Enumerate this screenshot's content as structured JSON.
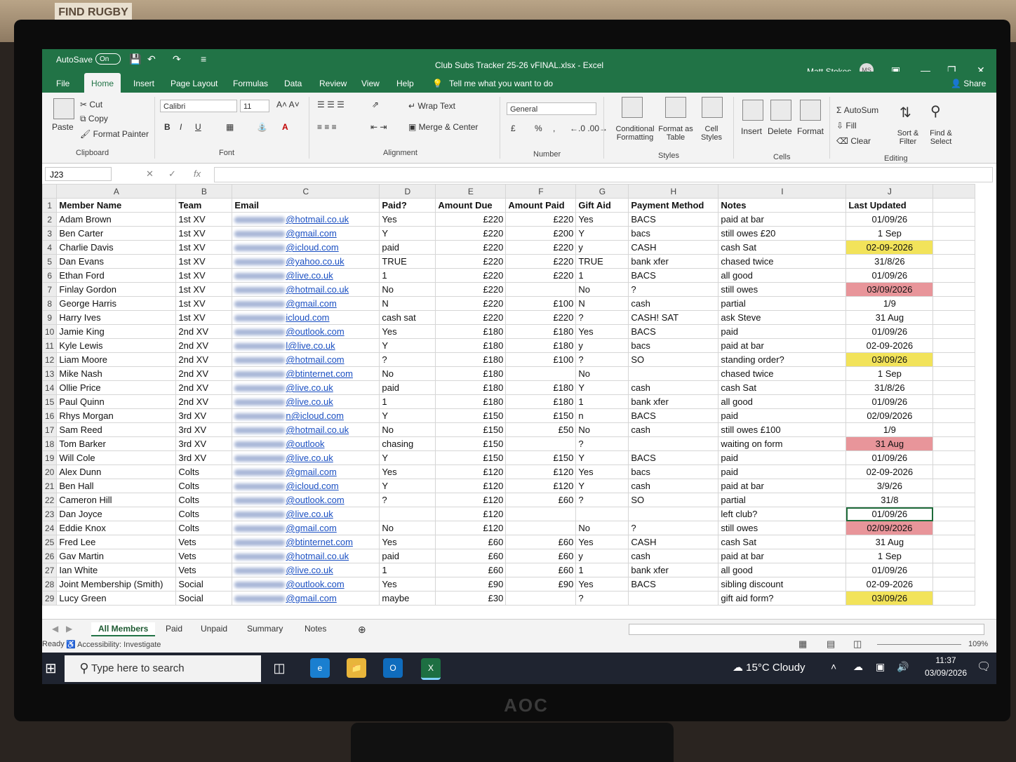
{
  "window": {
    "title": "Club Subs Tracker 25-26 vFINAL.xlsx  -  Excel",
    "autosave_label": "AutoSave",
    "autosave_state": "On",
    "user_name": "Matt Stokes",
    "user_initials": "MS",
    "share_label": "Share",
    "wall_sign": "FIND RUGBY",
    "monitor_brand": "AOC"
  },
  "menu": {
    "tabs": [
      "File",
      "Home",
      "Insert",
      "Page Layout",
      "Formulas",
      "Data",
      "Review",
      "View",
      "Help"
    ],
    "tell_me": "Tell me what you want to do"
  },
  "ribbon": {
    "clipboard": {
      "paste": "Paste",
      "cut": "Cut",
      "copy": "Copy",
      "format_painter": "Format Painter",
      "group": "Clipboard"
    },
    "font": {
      "name": "Calibri",
      "size": "11",
      "group": "Font"
    },
    "alignment": {
      "wrap": "Wrap Text",
      "merge": "Merge & Center",
      "group": "Alignment"
    },
    "number": {
      "format": "General",
      "group": "Number",
      "currency": "£",
      "percent": "%",
      "comma": ","
    },
    "styles": {
      "conditional": "Conditional Formatting",
      "format_table": "Format as Table",
      "cell_styles": "Cell Styles",
      "group": "Styles"
    },
    "cells": {
      "insert": "Insert",
      "delete": "Delete",
      "format": "Format",
      "group": "Cells"
    },
    "editing": {
      "autosum": "AutoSum",
      "fill": "Fill",
      "clear": "Clear",
      "sort": "Sort & Filter",
      "find": "Find & Select",
      "group": "Editing"
    }
  },
  "formula_bar": {
    "name_box": "J23",
    "fx": "fx"
  },
  "columns": [
    "A",
    "B",
    "C",
    "D",
    "E",
    "F",
    "G",
    "H",
    "I",
    "J"
  ],
  "header_row": [
    "Member Name",
    "Team",
    "Email",
    "Paid?",
    "Amount Due",
    "Amount Paid",
    "Gift Aid",
    "Payment Method",
    "Notes",
    "Last Updated"
  ],
  "rows": [
    {
      "n": "2",
      "a": "Adam Brown",
      "b": "1st XV",
      "c": "@hotmail.co.uk",
      "d": "Yes",
      "e": "£220",
      "f": "£220",
      "g": "Yes",
      "h": "BACS",
      "i": "paid at bar",
      "j": "01/09/26",
      "hl": ""
    },
    {
      "n": "3",
      "a": "Ben Carter",
      "b": "1st XV",
      "c": "@gmail.com",
      "d": "Y",
      "e": "£220",
      "f": "£200",
      "g": "Y",
      "h": "bacs",
      "i": "still owes £20",
      "j": "1 Sep",
      "hl": ""
    },
    {
      "n": "4",
      "a": "Charlie Davis",
      "b": "1st XV",
      "c": "@icloud.com",
      "d": "paid",
      "e": "£220",
      "f": "£220",
      "g": "y",
      "h": "CASH",
      "i": "cash Sat",
      "j": "02-09-2026",
      "hl": "yel"
    },
    {
      "n": "5",
      "a": "Dan Evans",
      "b": "1st XV",
      "c": "@yahoo.co.uk",
      "d": "TRUE",
      "e": "£220",
      "f": "£220",
      "g": "TRUE",
      "h": "bank xfer",
      "i": "chased twice",
      "j": "31/8/26",
      "hl": ""
    },
    {
      "n": "6",
      "a": "Ethan Ford",
      "b": "1st XV",
      "c": "@live.co.uk",
      "d": "1",
      "e": "£220",
      "f": "£220",
      "g": "1",
      "h": "BACS",
      "i": "all good",
      "j": "01/09/26",
      "hl": ""
    },
    {
      "n": "7",
      "a": "Finlay Gordon",
      "b": "1st XV",
      "c": "@hotmail.co.uk",
      "d": "No",
      "e": "£220",
      "f": "",
      "g": "No",
      "h": "?",
      "i": "still owes",
      "j": "03/09/2026",
      "hl": "red"
    },
    {
      "n": "8",
      "a": "George Harris",
      "b": "1st XV",
      "c": "@gmail.com",
      "d": "N",
      "e": "£220",
      "f": "£100",
      "g": "N",
      "h": "cash",
      "i": "partial",
      "j": "1/9",
      "hl": ""
    },
    {
      "n": "9",
      "a": "Harry Ives",
      "b": "1st XV",
      "c": "icloud.com",
      "d": "cash sat",
      "e": "£220",
      "f": "£220",
      "g": "?",
      "h": "CASH! SAT",
      "i": "ask Steve",
      "j": "31 Aug",
      "hl": ""
    },
    {
      "n": "10",
      "a": "Jamie King",
      "b": "2nd XV",
      "c": "@outlook.com",
      "d": "Yes",
      "e": "£180",
      "f": "£180",
      "g": "Yes",
      "h": "BACS",
      "i": "paid",
      "j": "01/09/26",
      "hl": ""
    },
    {
      "n": "11",
      "a": "Kyle Lewis",
      "b": "2nd XV",
      "c": "l@live.co.uk",
      "d": "Y",
      "e": "£180",
      "f": "£180",
      "g": "y",
      "h": "bacs",
      "i": "paid at bar",
      "j": "02-09-2026",
      "hl": ""
    },
    {
      "n": "12",
      "a": "Liam Moore",
      "b": "2nd XV",
      "c": "@hotmail.com",
      "d": "?",
      "e": "£180",
      "f": "£100",
      "g": "?",
      "h": "SO",
      "i": "standing order?",
      "j": "03/09/26",
      "hl": "yel"
    },
    {
      "n": "13",
      "a": "Mike Nash",
      "b": "2nd XV",
      "c": "@btinternet.com",
      "d": "No",
      "e": "£180",
      "f": "",
      "g": "No",
      "h": "",
      "i": "chased twice",
      "j": "1 Sep",
      "hl": ""
    },
    {
      "n": "14",
      "a": "Ollie Price",
      "b": "2nd XV",
      "c": "@live.co.uk",
      "d": "paid",
      "e": "£180",
      "f": "£180",
      "g": "Y",
      "h": "cash",
      "i": "cash Sat",
      "j": "31/8/26",
      "hl": ""
    },
    {
      "n": "15",
      "a": "Paul Quinn",
      "b": "2nd XV",
      "c": "@live.co.uk",
      "d": "1",
      "e": "£180",
      "f": "£180",
      "g": "1",
      "h": "bank xfer",
      "i": "all good",
      "j": "01/09/26",
      "hl": ""
    },
    {
      "n": "16",
      "a": "Rhys Morgan",
      "b": "3rd XV",
      "c": "n@icloud.com",
      "d": "Y",
      "e": "£150",
      "f": "£150",
      "g": "n",
      "h": "BACS",
      "i": "paid",
      "j": "02/09/2026",
      "hl": ""
    },
    {
      "n": "17",
      "a": "Sam Reed",
      "b": "3rd XV",
      "c": "@hotmail.co.uk",
      "d": "No",
      "e": "£150",
      "f": "£50",
      "g": "No",
      "h": "cash",
      "i": "still owes £100",
      "j": "1/9",
      "hl": ""
    },
    {
      "n": "18",
      "a": "Tom Barker",
      "b": "3rd XV",
      "c": "@outlook",
      "d": "chasing",
      "e": "£150",
      "f": "",
      "g": "?",
      "h": "",
      "i": "waiting on form",
      "j": "31 Aug",
      "hl": "red"
    },
    {
      "n": "19",
      "a": "Will Cole",
      "b": "3rd XV",
      "c": "@live.co.uk",
      "d": "Y",
      "e": "£150",
      "f": "£150",
      "g": "Y",
      "h": "BACS",
      "i": "paid",
      "j": "01/09/26",
      "hl": ""
    },
    {
      "n": "20",
      "a": "Alex Dunn",
      "b": "Colts",
      "c": "@gmail.com",
      "d": "Yes",
      "e": "£120",
      "f": "£120",
      "g": "Yes",
      "h": "bacs",
      "i": "paid",
      "j": "02-09-2026",
      "hl": ""
    },
    {
      "n": "21",
      "a": "Ben Hall",
      "b": "Colts",
      "c": "@icloud.com",
      "d": "Y",
      "e": "£120",
      "f": "£120",
      "g": "Y",
      "h": "cash",
      "i": "paid at bar",
      "j": "3/9/26",
      "hl": ""
    },
    {
      "n": "22",
      "a": "Cameron Hill",
      "b": "Colts",
      "c": "@outlook.com",
      "d": "?",
      "e": "£120",
      "f": "£60",
      "g": "?",
      "h": "SO",
      "i": "partial",
      "j": "31/8",
      "hl": ""
    },
    {
      "n": "23",
      "a": "Dan Joyce",
      "b": "Colts",
      "c": "@live.co.uk",
      "d": "",
      "e": "£120",
      "f": "",
      "g": "",
      "h": "",
      "i": "left club?",
      "j": "01/09/26",
      "hl": "sel"
    },
    {
      "n": "24",
      "a": "Eddie Knox",
      "b": "Colts",
      "c": "@gmail.com",
      "d": "No",
      "e": "£120",
      "f": "",
      "g": "No",
      "h": "?",
      "i": "still owes",
      "j": "02/09/2026",
      "hl": "red"
    },
    {
      "n": "25",
      "a": "Fred Lee",
      "b": "Vets",
      "c": "@btinternet.com",
      "d": "Yes",
      "e": "£60",
      "f": "£60",
      "g": "Yes",
      "h": "CASH",
      "i": "cash Sat",
      "j": "31 Aug",
      "hl": ""
    },
    {
      "n": "26",
      "a": "Gav Martin",
      "b": "Vets",
      "c": "@hotmail.co.uk",
      "d": "paid",
      "e": "£60",
      "f": "£60",
      "g": "y",
      "h": "cash",
      "i": "paid at bar",
      "j": "1 Sep",
      "hl": ""
    },
    {
      "n": "27",
      "a": "Ian White",
      "b": "Vets",
      "c": "@live.co.uk",
      "d": "1",
      "e": "£60",
      "f": "£60",
      "g": "1",
      "h": "bank xfer",
      "i": "all good",
      "j": "01/09/26",
      "hl": ""
    },
    {
      "n": "28",
      "a": "Joint Membership (Smith)",
      "b": "Social",
      "c": "@outlook.com",
      "d": "Yes",
      "e": "£90",
      "f": "£90",
      "g": "Yes",
      "h": "BACS",
      "i": "sibling discount",
      "j": "02-09-2026",
      "hl": ""
    },
    {
      "n": "29",
      "a": "Lucy Green",
      "b": "Social",
      "c": "@gmail.com",
      "d": "maybe",
      "e": "£30",
      "f": "",
      "g": "?",
      "h": "",
      "i": "gift aid form?",
      "j": "03/09/26",
      "hl": "yel"
    }
  ],
  "sheet_tabs": [
    "All Members",
    "Paid",
    "Unpaid",
    "Summary",
    "Notes"
  ],
  "status": {
    "ready": "Ready",
    "accessibility": "Accessibility: Investigate",
    "zoom": "109%"
  },
  "taskbar": {
    "search_placeholder": "Type here to search",
    "weather": "15°C  Cloudy",
    "time": "11:37",
    "date": "03/09/2026"
  }
}
